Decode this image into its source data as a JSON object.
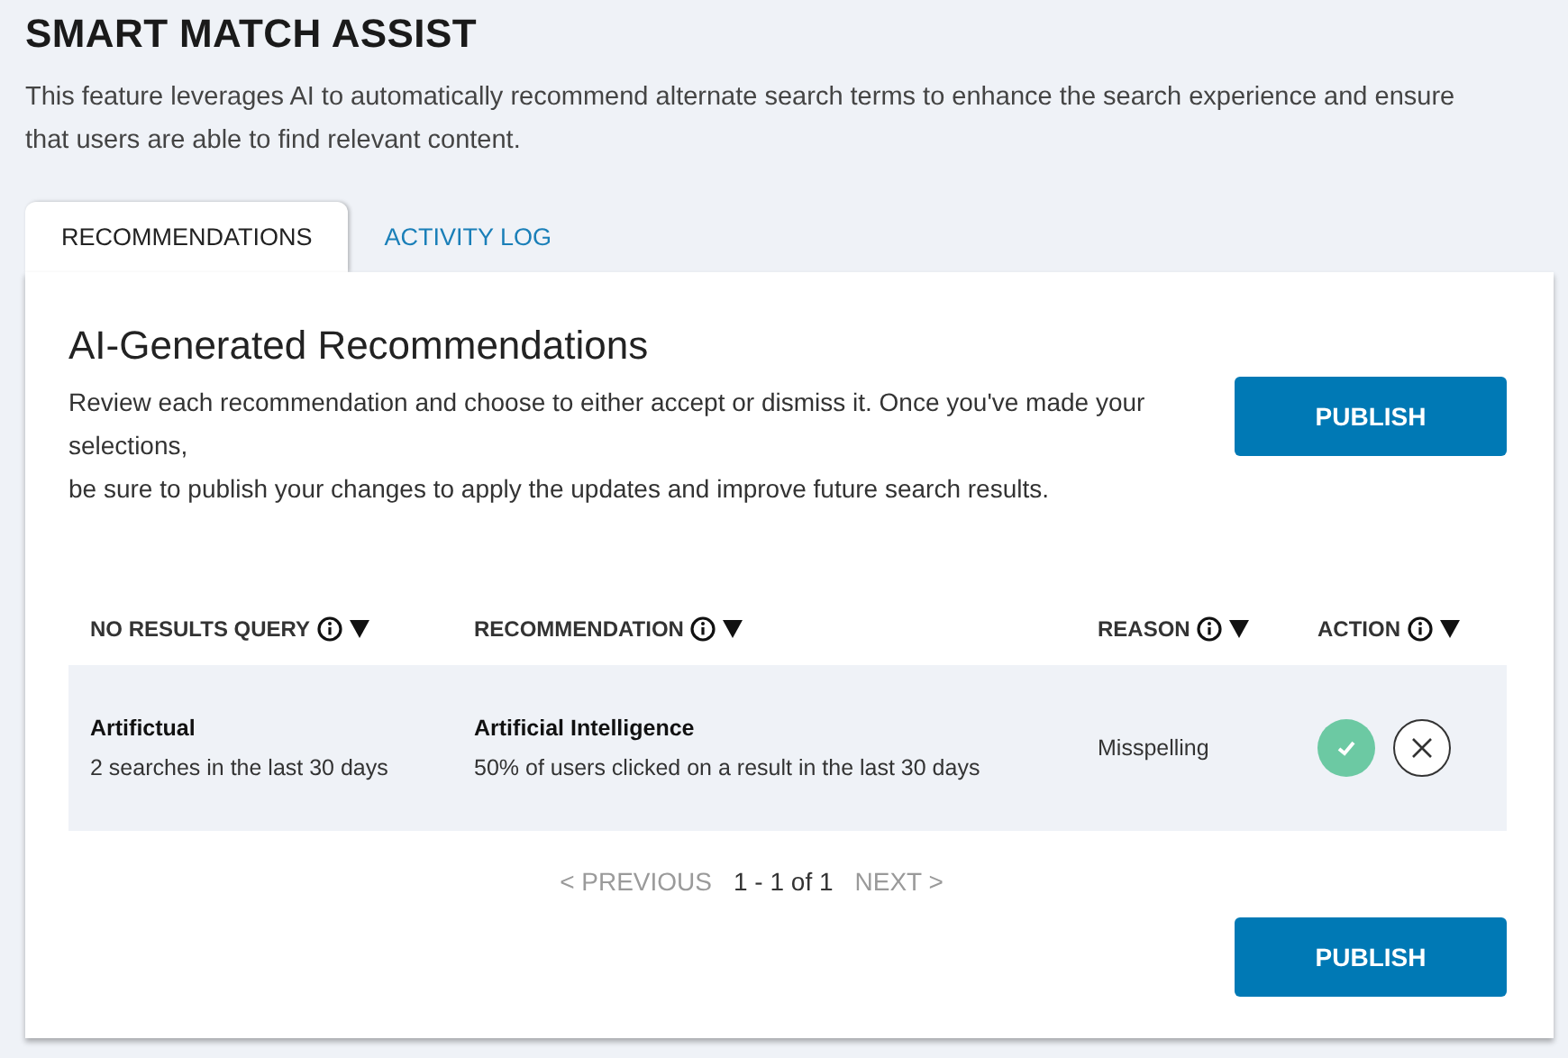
{
  "title": "SMART MATCH ASSIST",
  "description": "This feature leverages AI to automatically recommend alternate search terms to enhance the search experience and ensure that users are able to find relevant content.",
  "tabs": [
    {
      "label": "RECOMMENDATIONS",
      "selected": true
    },
    {
      "label": "ACTIVITY LOG",
      "selected": false
    }
  ],
  "panel": {
    "heading": "AI-Generated Recommendations",
    "intro": "Review each recommendation and choose to either accept or dismiss it. Once you've made your selections,\nbe sure to publish your changes to apply the updates and improve future search results.",
    "publish_top": "PUBLISH",
    "columns": [
      {
        "label": "NO RESULTS QUERY"
      },
      {
        "label": "RECOMMENDATION"
      },
      {
        "label": "REASON"
      },
      {
        "label": "ACTION"
      }
    ],
    "rows": [
      {
        "query": "Artifictual",
        "query_detail": "2 searches in the last 30 days",
        "recommendation": "Artificial Intelligence",
        "recommendation_detail": "50% of users clicked on a result in the last 30 days",
        "reason": "Misspelling",
        "accepted": true
      }
    ],
    "pagination": {
      "previous": {
        "label": "< PREVIOUS",
        "disabled": true
      },
      "range": "1 - 1 of 1",
      "next": {
        "label": "NEXT >",
        "disabled": true
      }
    },
    "publish_bottom": "PUBLISH"
  }
}
